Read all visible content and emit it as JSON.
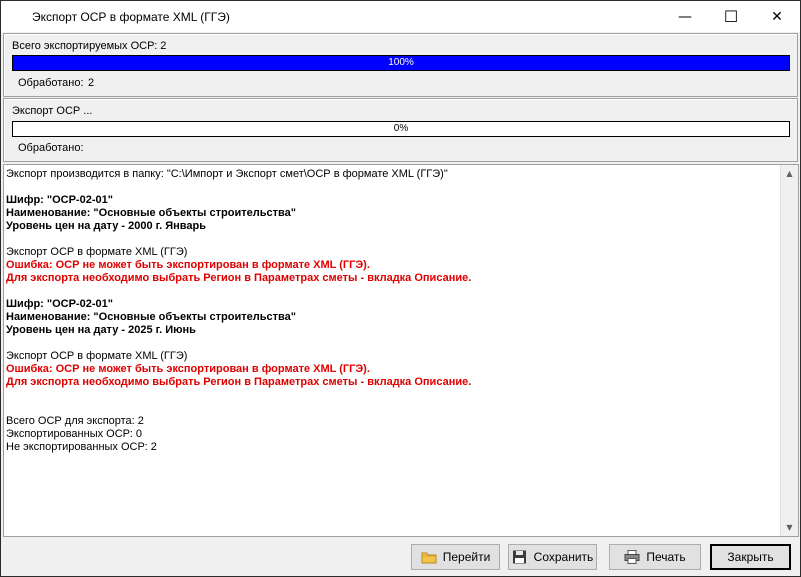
{
  "window": {
    "title": "Экспорт ОСР в формате XML (ГГЭ)"
  },
  "window_controls": {
    "minimize": "—",
    "maximize": "☐",
    "close": "✕"
  },
  "total_panel": {
    "label": "Всего экспортируемых ОСР: 2",
    "progress_percent": 100,
    "progress_text": "100%",
    "processed_label": "Обработано:",
    "processed_value": "2"
  },
  "current_panel": {
    "label": "Экспорт ОСР ...",
    "progress_percent": 0,
    "progress_text": "0%",
    "processed_label": "Обработано:",
    "processed_value": ""
  },
  "log": {
    "lines": [
      {
        "text": "Экспорт производится в папку: \"C:\\Импорт и Экспорт смет\\ОСР в формате XML (ГГЭ)\"",
        "style": "normal"
      },
      {
        "text": "",
        "style": "normal"
      },
      {
        "text": "Шифр: \"ОСР-02-01\"",
        "style": "bold"
      },
      {
        "text": "Наименование: \"Основные объекты строительства\"",
        "style": "bold"
      },
      {
        "text": "Уровень цен на дату - 2000 г. Январь",
        "style": "bold"
      },
      {
        "text": "",
        "style": "normal"
      },
      {
        "text": "Экспорт ОСР в формате XML (ГГЭ)",
        "style": "normal"
      },
      {
        "text": "Ошибка: ОСР не может быть экспортирован в формате XML (ГГЭ).",
        "style": "error"
      },
      {
        "text": "Для экспорта необходимо выбрать Регион в Параметрах сметы - вкладка Описание.",
        "style": "error"
      },
      {
        "text": "",
        "style": "normal"
      },
      {
        "text": "Шифр: \"ОСР-02-01\"",
        "style": "bold"
      },
      {
        "text": "Наименование: \"Основные объекты строительства\"",
        "style": "bold"
      },
      {
        "text": "Уровень цен на дату - 2025 г. Июнь",
        "style": "bold"
      },
      {
        "text": "",
        "style": "normal"
      },
      {
        "text": "Экспорт ОСР в формате XML (ГГЭ)",
        "style": "normal"
      },
      {
        "text": "Ошибка: ОСР не может быть экспортирован в формате XML (ГГЭ).",
        "style": "error"
      },
      {
        "text": "Для экспорта необходимо выбрать Регион в Параметрах сметы - вкладка Описание.",
        "style": "error"
      },
      {
        "text": "",
        "style": "normal"
      },
      {
        "text": "",
        "style": "normal"
      },
      {
        "text": "Всего ОСР для экспорта: 2",
        "style": "normal"
      },
      {
        "text": "Экспортированных ОСР: 0",
        "style": "normal"
      },
      {
        "text": "Не экспортированных ОСР: 2",
        "style": "normal"
      }
    ]
  },
  "buttons": {
    "goto": {
      "label": "Перейти",
      "icon": "folder-icon"
    },
    "save": {
      "label": "Сохранить",
      "icon": "floppy-disk-icon"
    },
    "print": {
      "label": "Печать",
      "icon": "printer-icon"
    },
    "close": {
      "label": "Закрыть"
    }
  },
  "colors": {
    "progress_fill": "#0000ff",
    "error_text": "#e00000"
  }
}
